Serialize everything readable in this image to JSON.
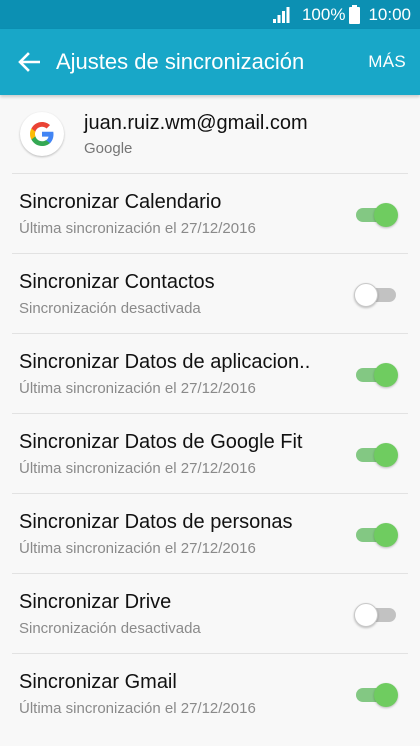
{
  "status_bar": {
    "battery_percent": "100%",
    "time": "10:00",
    "signal_icon": "signal-icon",
    "battery_icon": "battery-icon"
  },
  "app_bar": {
    "title": "Ajustes de sincronización",
    "more_label": "MÁS",
    "back_icon": "back-arrow-icon",
    "color": "#18a7c8",
    "status_color": "#0c90b3"
  },
  "account": {
    "email": "juan.ruiz.wm@gmail.com",
    "provider": "Google",
    "logo_icon": "google-logo-icon"
  },
  "sync_items": [
    {
      "label": "Sincronizar Calendario",
      "status": "Última sincronización el 27/12/2016",
      "enabled": true
    },
    {
      "label": "Sincronizar Contactos",
      "status": "Sincronización desactivada",
      "enabled": false
    },
    {
      "label": "Sincronizar Datos de aplicacion..",
      "status": "Última sincronización el 27/12/2016",
      "enabled": true
    },
    {
      "label": "Sincronizar Datos de Google Fit",
      "status": "Última sincronización el 27/12/2016",
      "enabled": true
    },
    {
      "label": "Sincronizar Datos de personas",
      "status": "Última sincronización el 27/12/2016",
      "enabled": true
    },
    {
      "label": "Sincronizar Drive",
      "status": "Sincronización desactivada",
      "enabled": false
    },
    {
      "label": "Sincronizar Gmail",
      "status": "Última sincronización el 27/12/2016",
      "enabled": true
    }
  ],
  "toggle_on_color": "#6fcc60"
}
